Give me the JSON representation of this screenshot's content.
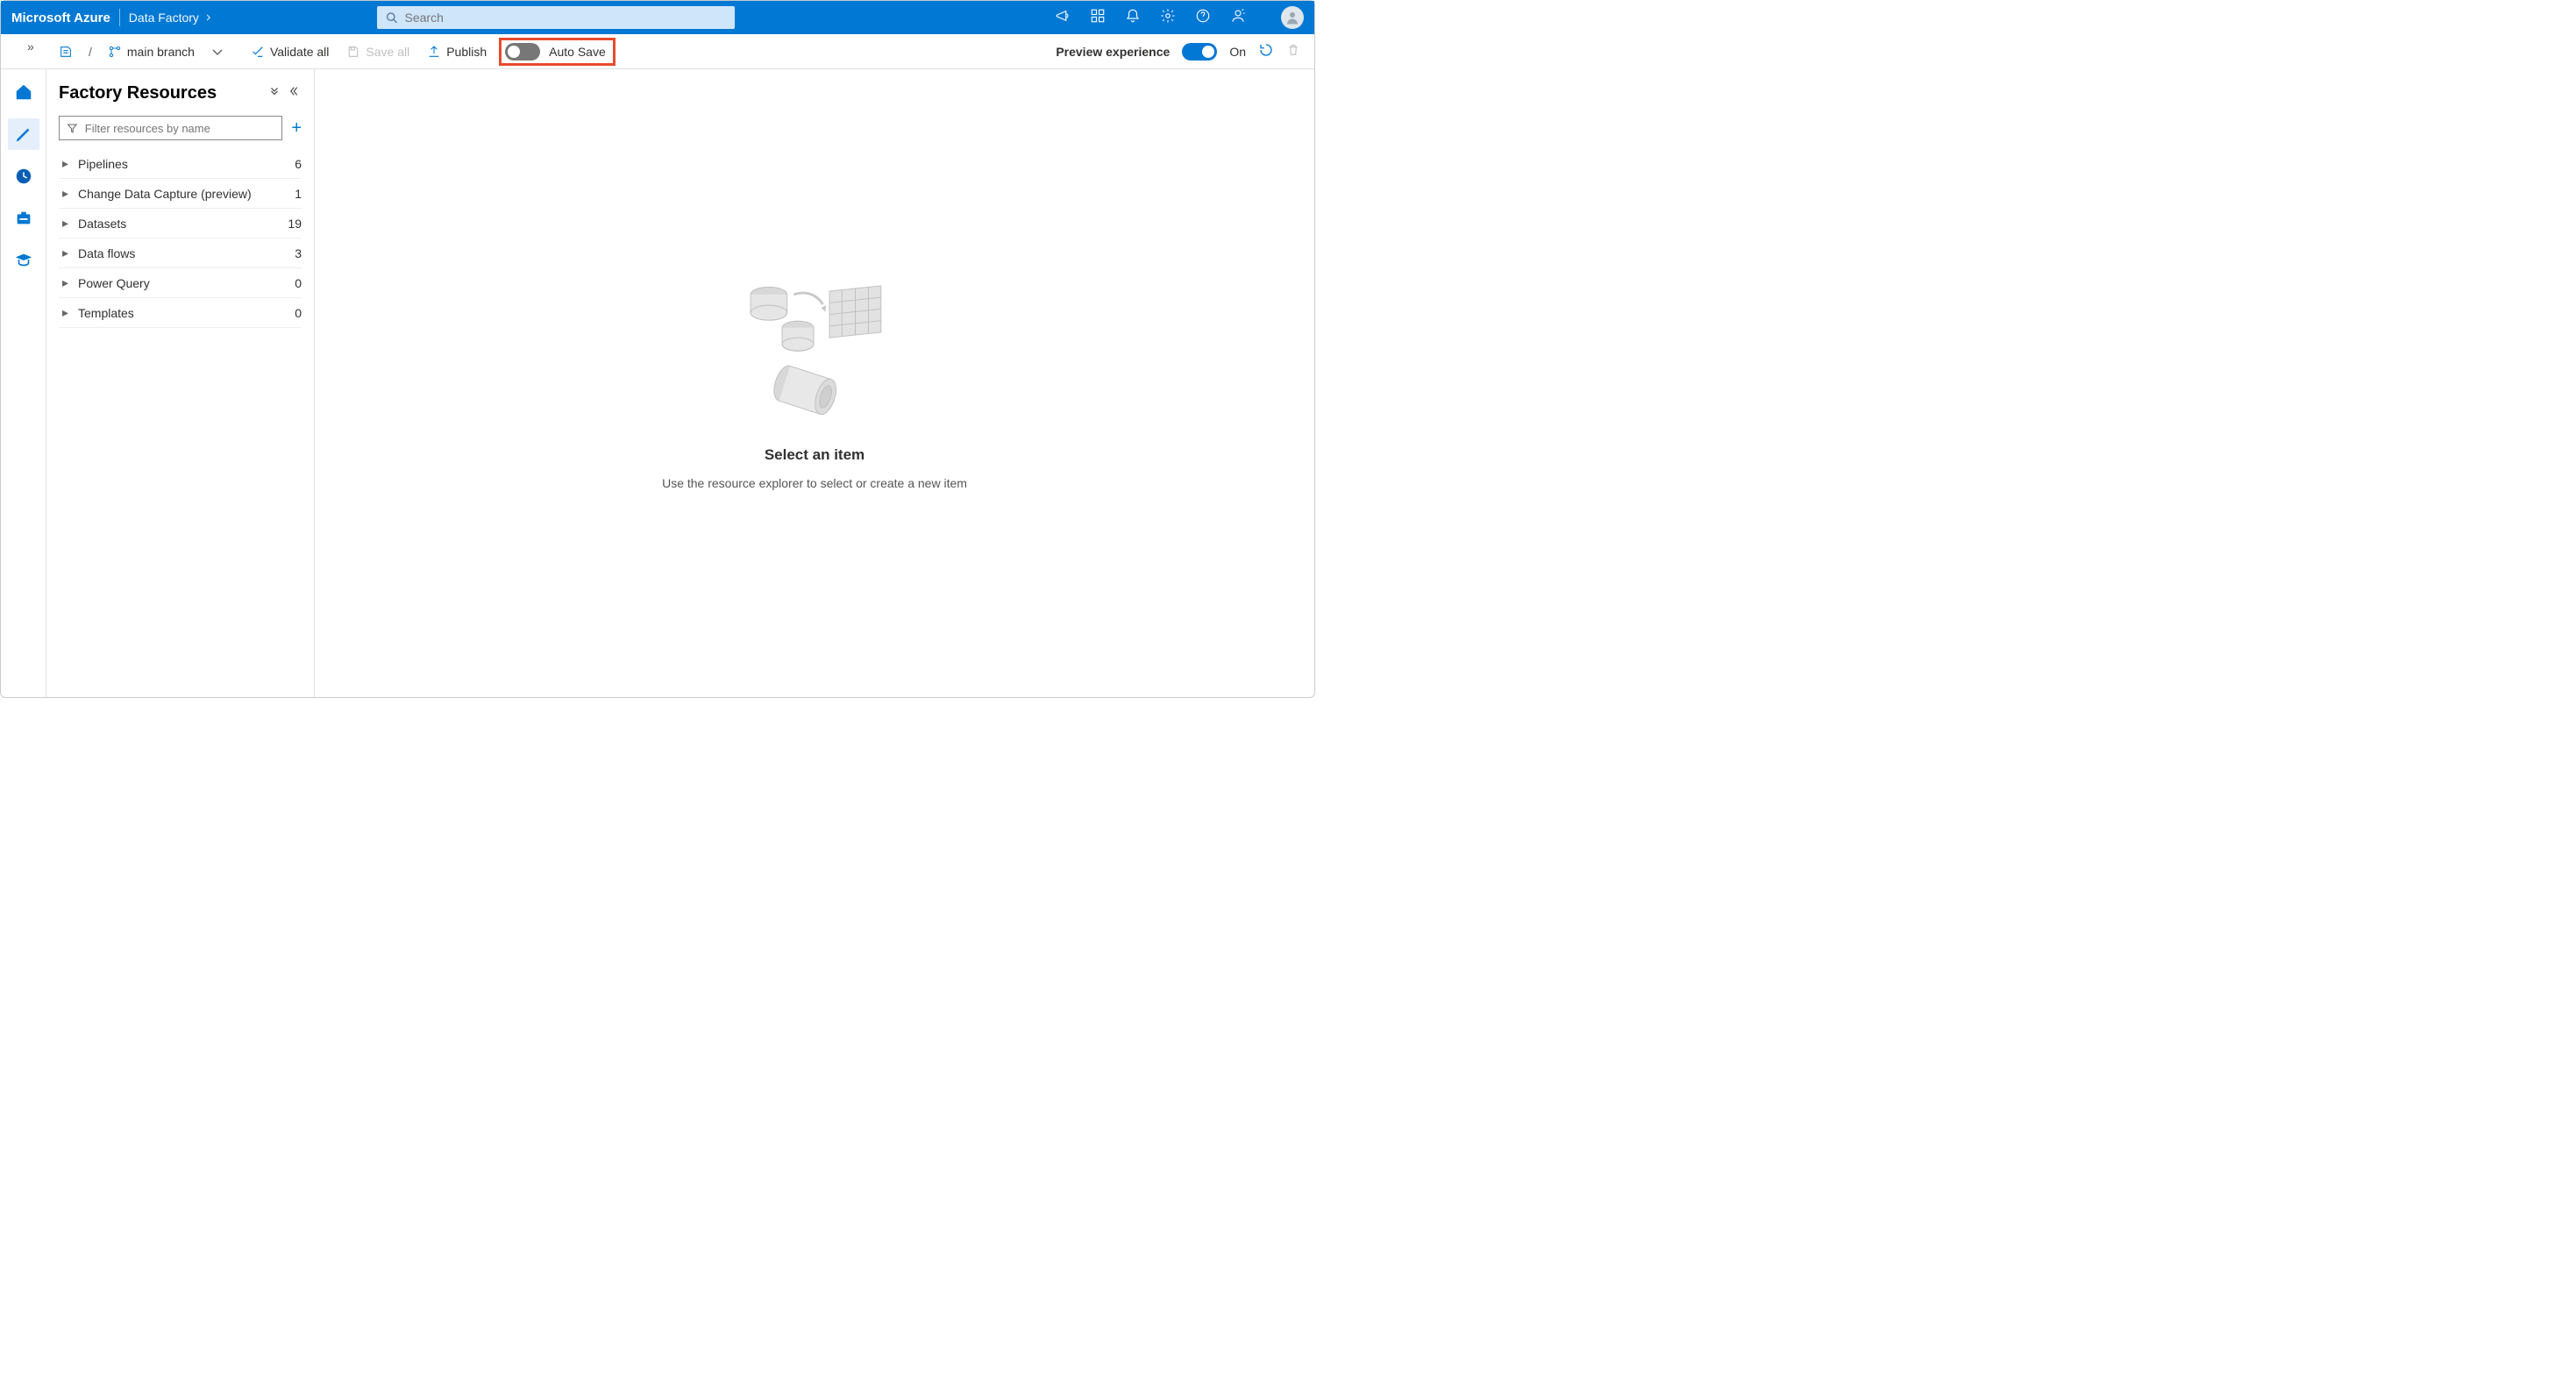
{
  "header": {
    "brand": "Microsoft Azure",
    "crumb": "Data Factory",
    "search_placeholder": "Search"
  },
  "toolbar": {
    "branch": "main branch",
    "validate": "Validate all",
    "save": "Save all",
    "publish": "Publish",
    "autosave": "Auto Save",
    "preview_label": "Preview experience",
    "preview_state": "On"
  },
  "sidebar": {
    "title": "Factory Resources",
    "filter_placeholder": "Filter resources by name",
    "items": [
      {
        "label": "Pipelines",
        "count": "6"
      },
      {
        "label": "Change Data Capture (preview)",
        "count": "1"
      },
      {
        "label": "Datasets",
        "count": "19"
      },
      {
        "label": "Data flows",
        "count": "3"
      },
      {
        "label": "Power Query",
        "count": "0"
      },
      {
        "label": "Templates",
        "count": "0"
      }
    ]
  },
  "canvas": {
    "title": "Select an item",
    "subtitle": "Use the resource explorer to select or create a new item"
  }
}
